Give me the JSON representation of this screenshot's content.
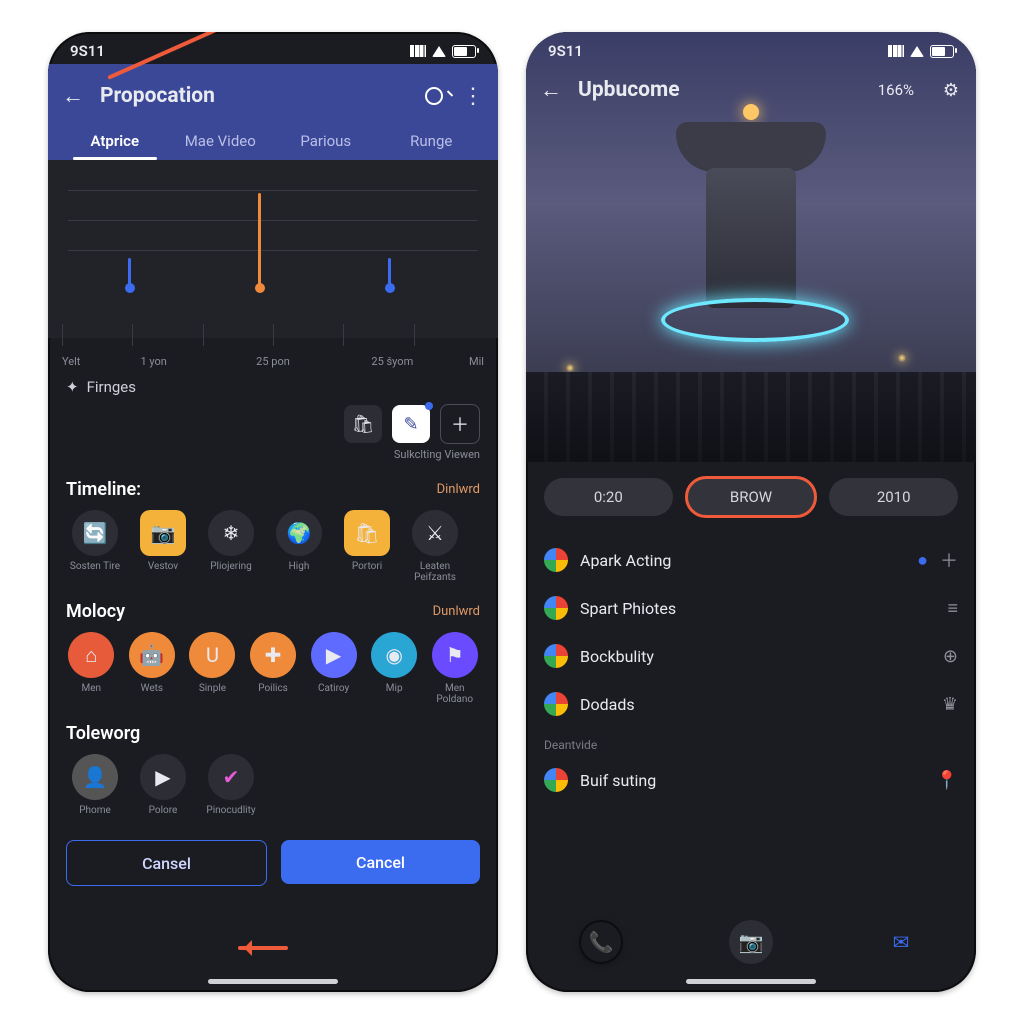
{
  "status": {
    "time": "9S11"
  },
  "left": {
    "title": "Propocation",
    "tabs": [
      "Atprice",
      "Mae Video",
      "Parious",
      "Runge"
    ],
    "chart_data": {
      "type": "line",
      "categories": [
        "Yelt",
        "1 yon",
        "25 pon",
        "25 šyom",
        "Mil"
      ],
      "values": [
        35,
        35,
        70,
        35,
        35
      ],
      "ylim": [
        0,
        100
      ],
      "title": "",
      "xlabel": "",
      "ylabel": ""
    },
    "finges_label": "Firnges",
    "tool_caption": "Sulkclting Viewen",
    "timeline_label": "Timeline:",
    "timeline_link": "Dinlwrd",
    "timeline_items": [
      {
        "label": "Sosten Tire"
      },
      {
        "label": "Vestov"
      },
      {
        "label": "Pliojering"
      },
      {
        "label": "High"
      },
      {
        "label": "Portori"
      },
      {
        "label": "Leaten Peifzants"
      }
    ],
    "molocy_label": "Molocy",
    "molocy_link": "Dunlwrd",
    "molocy_items": [
      {
        "label": "Men"
      },
      {
        "label": "Wets"
      },
      {
        "label": "Sinple"
      },
      {
        "label": "Poilics"
      },
      {
        "label": "Catiroy"
      },
      {
        "label": "Mip"
      },
      {
        "label": "Men Poldano"
      }
    ],
    "toleworg_label": "Toleworg",
    "toleworg_items": [
      {
        "label": "Phome"
      },
      {
        "label": "Polore"
      },
      {
        "label": "Pinocudlity"
      }
    ],
    "btn_cancel_outline": "Cansel",
    "btn_cancel_fill": "Cancel"
  },
  "right": {
    "title": "Upbucome",
    "percent": "166%",
    "pills": [
      "0:20",
      "BROW",
      "2010"
    ],
    "list": [
      {
        "label": "Apark Acting",
        "right": "dot"
      },
      {
        "label": "Spart Phiotes",
        "right": "menu"
      },
      {
        "label": "Bockbulity",
        "right": "globe"
      },
      {
        "label": "Dodads",
        "right": "crown"
      }
    ],
    "sub_header": "Deantvide",
    "sub_item": "Buif suting"
  }
}
